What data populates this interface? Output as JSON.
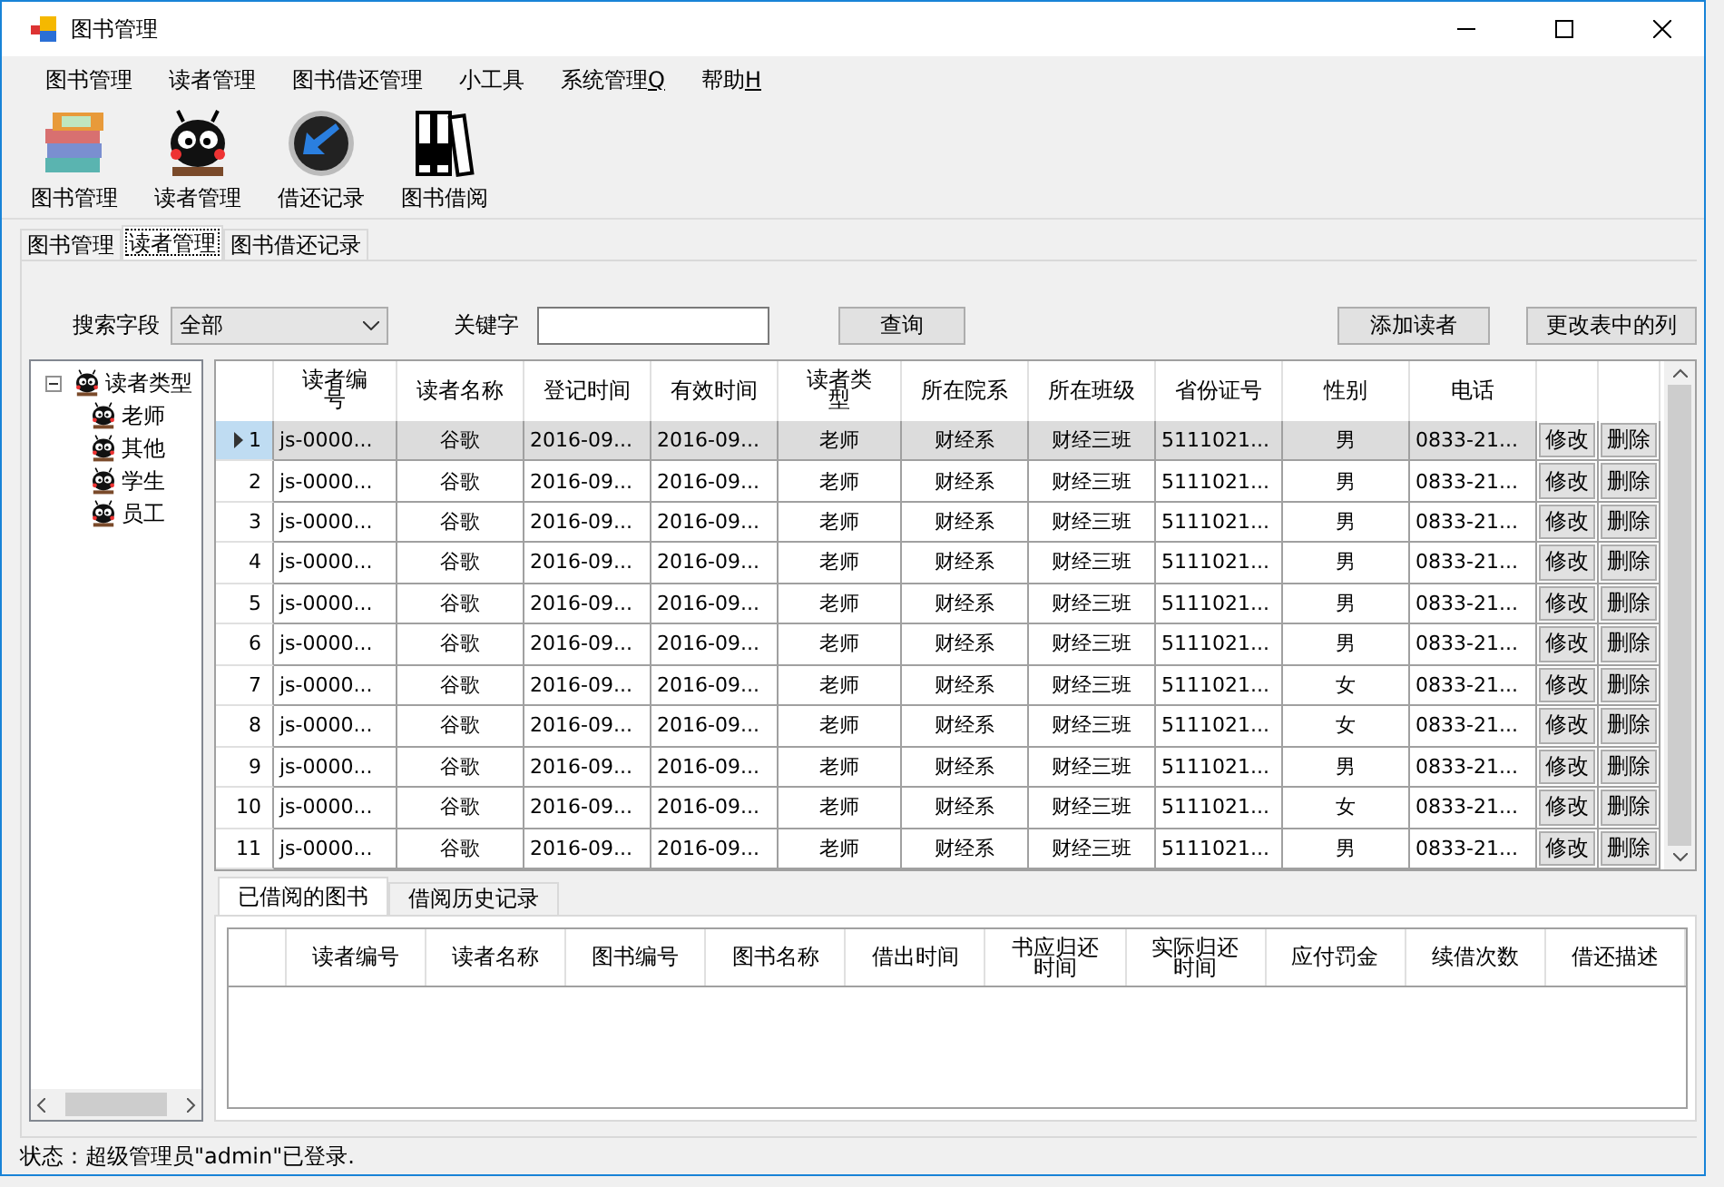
{
  "window": {
    "title": "图书管理"
  },
  "menu": [
    {
      "label": "图书管理"
    },
    {
      "label": "读者管理"
    },
    {
      "label": "图书借还管理"
    },
    {
      "label": "小工具"
    },
    {
      "label": "系统管理",
      "mnemonic": "Q"
    },
    {
      "label": "帮助",
      "mnemonic": "H"
    }
  ],
  "toolbar": [
    {
      "label": "图书管理",
      "kind": "books"
    },
    {
      "label": "读者管理",
      "kind": "reader"
    },
    {
      "label": "借还记录",
      "kind": "clock"
    },
    {
      "label": "图书借阅",
      "kind": "binders"
    }
  ],
  "tabs": [
    {
      "label": "图书管理",
      "selected": false
    },
    {
      "label": "读者管理",
      "selected": true
    },
    {
      "label": "图书借还记录",
      "selected": false
    }
  ],
  "search": {
    "field_label": "搜索字段",
    "field_value": "全部",
    "keyword_label": "关键字",
    "query_button": "查询",
    "add_button": "添加读者",
    "columns_button": "更改表中的列"
  },
  "tree": {
    "label": "读者类型",
    "expanded": true,
    "children": [
      {
        "label": "老师"
      },
      {
        "label": "其他"
      },
      {
        "label": "学生"
      },
      {
        "label": "员工"
      }
    ]
  },
  "readers_table": {
    "columns": [
      "读者编号",
      "读者名称",
      "登记时间",
      "有效时间",
      "读者类型",
      "所在院系",
      "所在班级",
      "省份证号",
      "性别",
      "电话"
    ],
    "rows": [
      {
        "number": "1",
        "selected": true,
        "cells": [
          "js-0000...",
          "谷歌",
          "2016-09...",
          "2016-09...",
          "老师",
          "财经系",
          "财经三班",
          "5111021...",
          "男",
          "0833-21..."
        ],
        "edit": "修改",
        "delete": "删除"
      },
      {
        "number": "2",
        "selected": false,
        "cells": [
          "js-0000...",
          "谷歌",
          "2016-09...",
          "2016-09...",
          "老师",
          "财经系",
          "财经三班",
          "5111021...",
          "男",
          "0833-21..."
        ],
        "edit": "修改",
        "delete": "删除"
      },
      {
        "number": "3",
        "selected": false,
        "cells": [
          "js-0000...",
          "谷歌",
          "2016-09...",
          "2016-09...",
          "老师",
          "财经系",
          "财经三班",
          "5111021...",
          "男",
          "0833-21..."
        ],
        "edit": "修改",
        "delete": "删除"
      },
      {
        "number": "4",
        "selected": false,
        "cells": [
          "js-0000...",
          "谷歌",
          "2016-09...",
          "2016-09...",
          "老师",
          "财经系",
          "财经三班",
          "5111021...",
          "男",
          "0833-21..."
        ],
        "edit": "修改",
        "delete": "删除"
      },
      {
        "number": "5",
        "selected": false,
        "cells": [
          "js-0000...",
          "谷歌",
          "2016-09...",
          "2016-09...",
          "老师",
          "财经系",
          "财经三班",
          "5111021...",
          "男",
          "0833-21..."
        ],
        "edit": "修改",
        "delete": "删除"
      },
      {
        "number": "6",
        "selected": false,
        "cells": [
          "js-0000...",
          "谷歌",
          "2016-09...",
          "2016-09...",
          "老师",
          "财经系",
          "财经三班",
          "5111021...",
          "男",
          "0833-21..."
        ],
        "edit": "修改",
        "delete": "删除"
      },
      {
        "number": "7",
        "selected": false,
        "cells": [
          "js-0000...",
          "谷歌",
          "2016-09...",
          "2016-09...",
          "老师",
          "财经系",
          "财经三班",
          "5111021...",
          "女",
          "0833-21..."
        ],
        "edit": "修改",
        "delete": "删除"
      },
      {
        "number": "8",
        "selected": false,
        "cells": [
          "js-0000...",
          "谷歌",
          "2016-09...",
          "2016-09...",
          "老师",
          "财经系",
          "财经三班",
          "5111021...",
          "女",
          "0833-21..."
        ],
        "edit": "修改",
        "delete": "删除"
      },
      {
        "number": "9",
        "selected": false,
        "cells": [
          "js-0000...",
          "谷歌",
          "2016-09...",
          "2016-09...",
          "老师",
          "财经系",
          "财经三班",
          "5111021...",
          "男",
          "0833-21..."
        ],
        "edit": "修改",
        "delete": "删除"
      },
      {
        "number": "10",
        "selected": false,
        "cells": [
          "js-0000...",
          "谷歌",
          "2016-09...",
          "2016-09...",
          "老师",
          "财经系",
          "财经三班",
          "5111021...",
          "女",
          "0833-21..."
        ],
        "edit": "修改",
        "delete": "删除"
      },
      {
        "number": "11",
        "selected": false,
        "cells": [
          "js-0000...",
          "谷歌",
          "2016-09...",
          "2016-09...",
          "老师",
          "财经系",
          "财经三班",
          "5111021...",
          "男",
          "0833-21..."
        ],
        "edit": "修改",
        "delete": "删除"
      }
    ]
  },
  "bottom_tabs": [
    {
      "label": "已借阅的图书",
      "selected": true
    },
    {
      "label": "借阅历史记录",
      "selected": false
    }
  ],
  "borrowed_table": {
    "columns": [
      "读者编号",
      "读者名称",
      "图书编号",
      "图书名称",
      "借出时间",
      "书应归还时间",
      "实际归还时间",
      "应付罚金",
      "续借次数",
      "借还描述"
    ]
  },
  "status_bar": "状态：超级管理员\"admin\"已登录."
}
